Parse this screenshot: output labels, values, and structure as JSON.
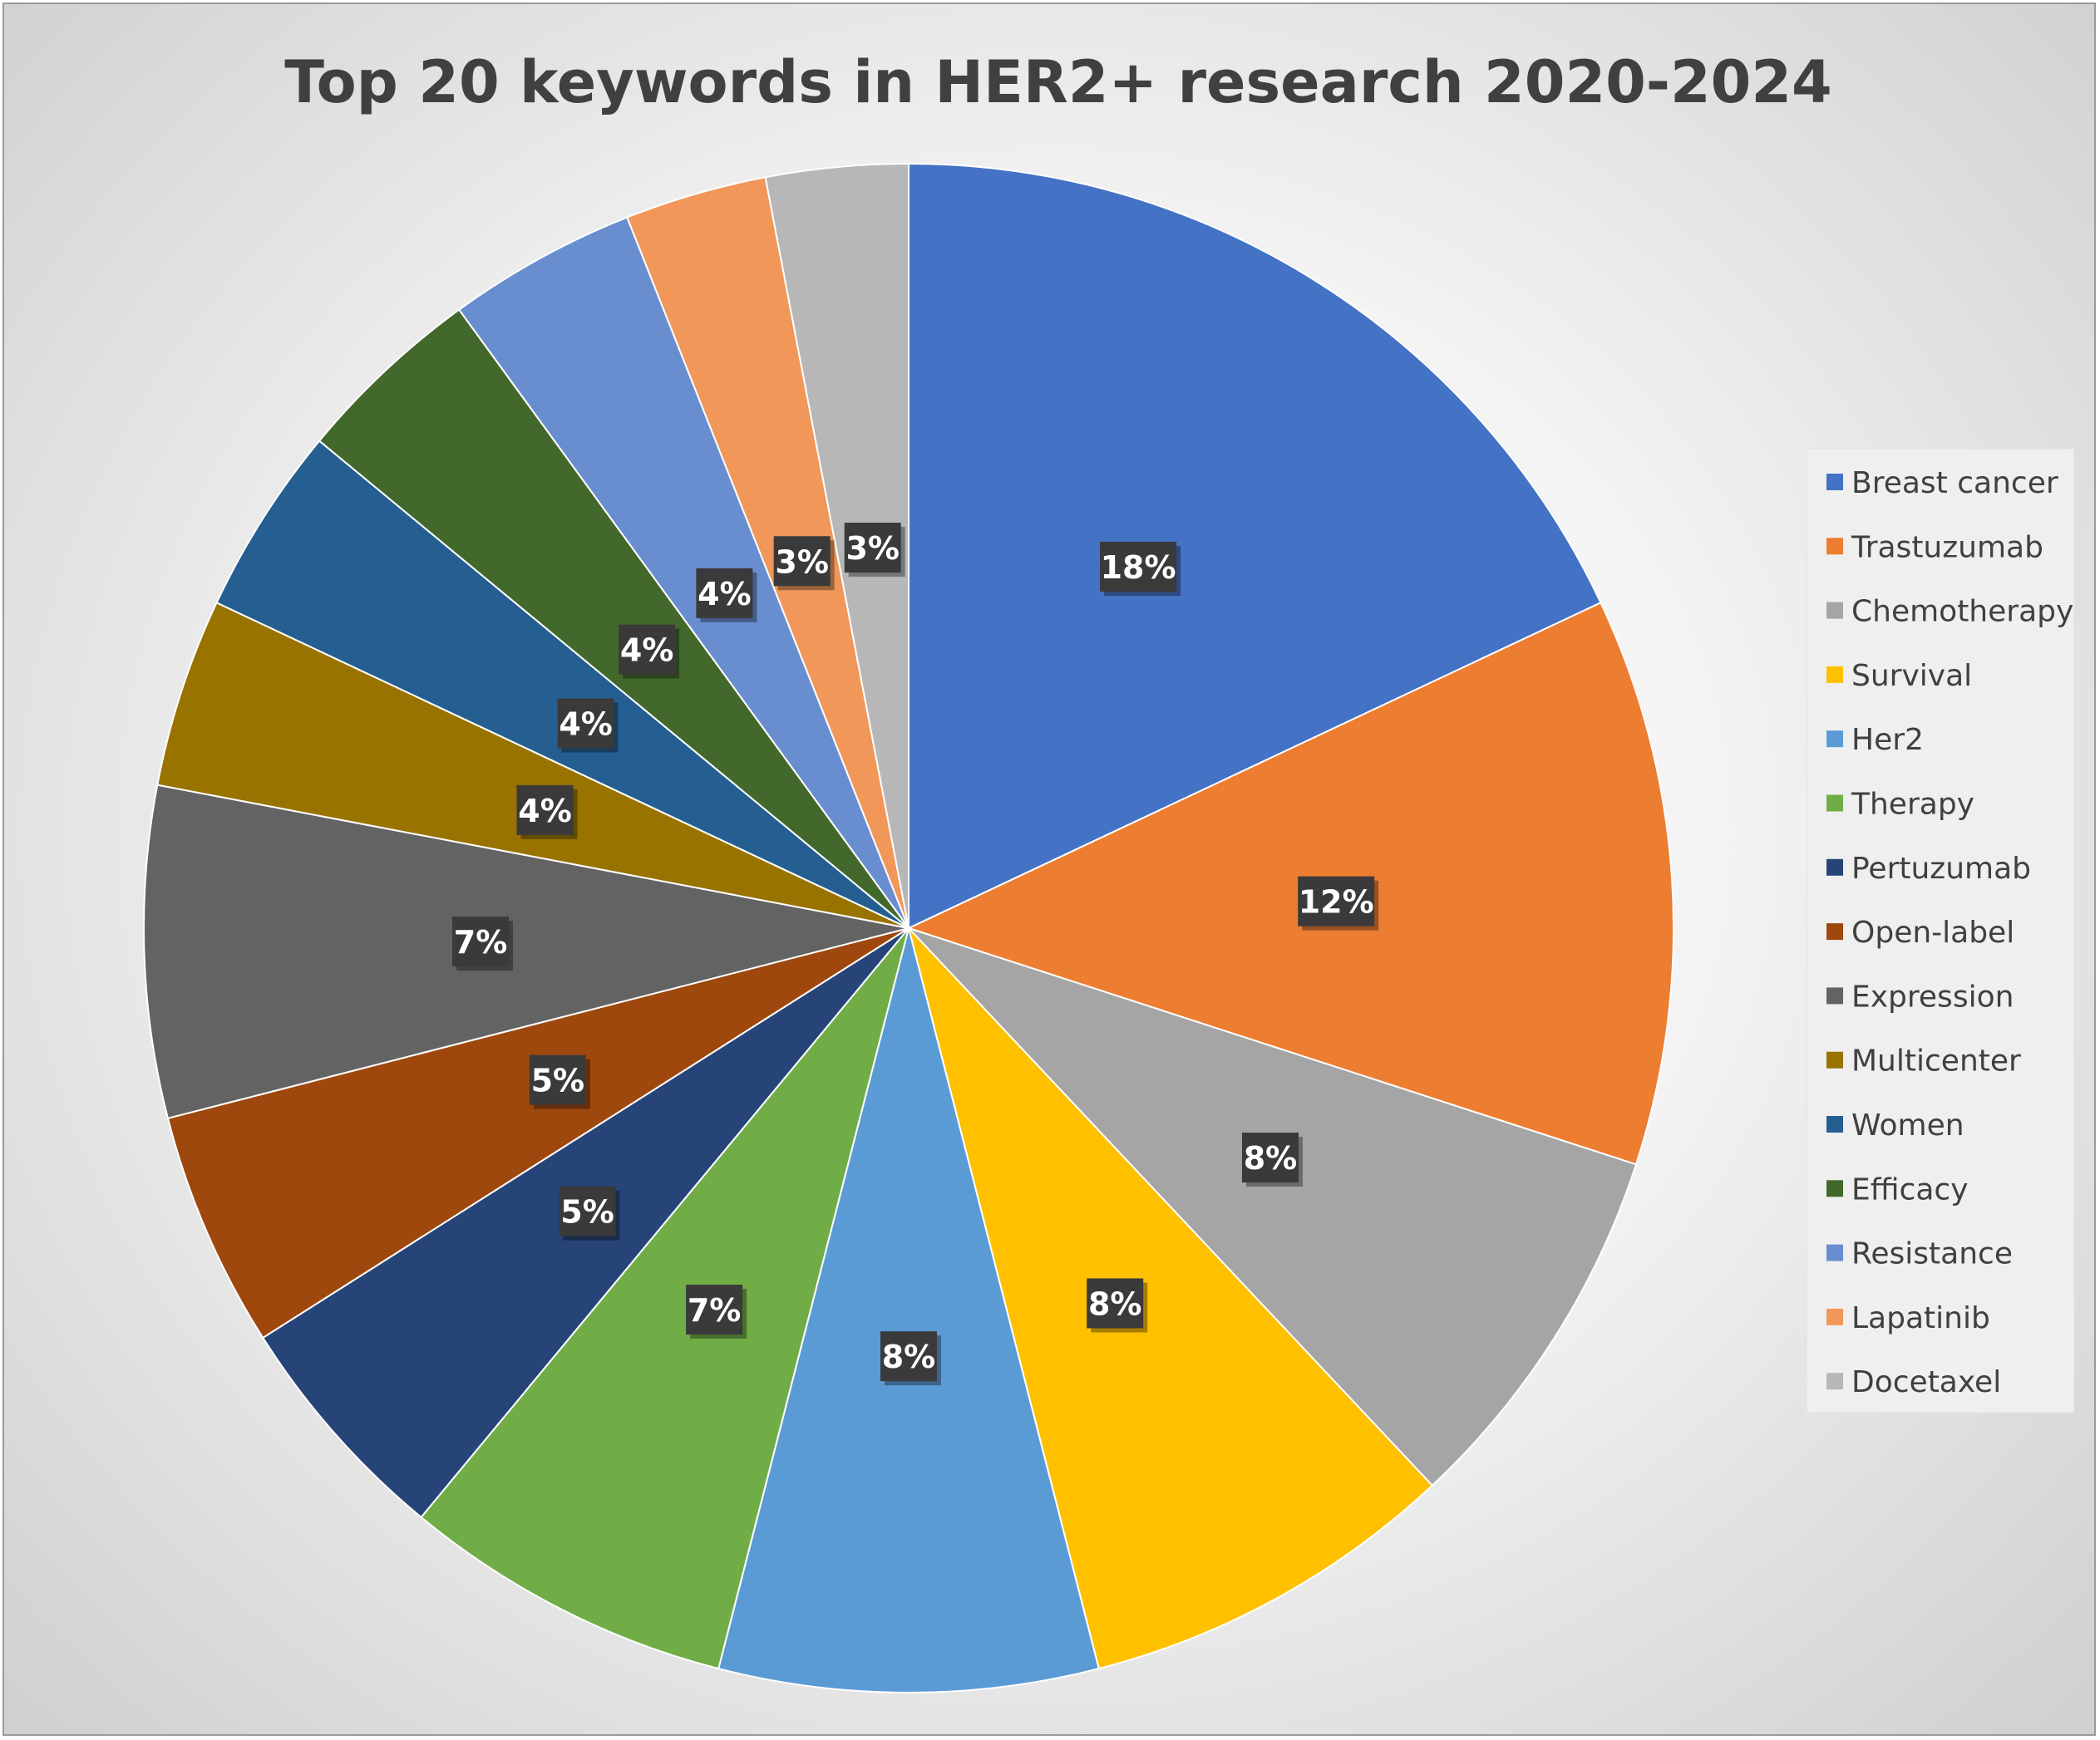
{
  "chart_data": {
    "type": "pie",
    "title": "Top 20 keywords in HER2+ research 2020-2024",
    "legend_position": "right",
    "slices": [
      {
        "label": "Breast cancer",
        "value": 18,
        "display": "18%",
        "color": "#4472C4"
      },
      {
        "label": "Trastuzumab",
        "value": 12,
        "display": "12%",
        "color": "#ED7D31"
      },
      {
        "label": "Chemotherapy",
        "value": 8,
        "display": "8%",
        "color": "#A5A5A5"
      },
      {
        "label": "Survival",
        "value": 8,
        "display": "8%",
        "color": "#FFC000"
      },
      {
        "label": "Her2",
        "value": 8,
        "display": "8%",
        "color": "#5B9BD5"
      },
      {
        "label": "Therapy",
        "value": 7,
        "display": "7%",
        "color": "#70AD47"
      },
      {
        "label": "Pertuzumab",
        "value": 5,
        "display": "5%",
        "color": "#264478"
      },
      {
        "label": "Open-label",
        "value": 5,
        "display": "5%",
        "color": "#9E480E"
      },
      {
        "label": "Expression",
        "value": 7,
        "display": "7%",
        "color": "#636363"
      },
      {
        "label": "Multicenter",
        "value": 4,
        "display": "4%",
        "color": "#997300"
      },
      {
        "label": "Women",
        "value": 4,
        "display": "4%",
        "color": "#255E91"
      },
      {
        "label": "Efficacy",
        "value": 4,
        "display": "4%",
        "color": "#43682B"
      },
      {
        "label": "Resistance",
        "value": 4,
        "display": "4%",
        "color": "#698ED0"
      },
      {
        "label": "Lapatinib",
        "value": 3,
        "display": "3%",
        "color": "#F1975A"
      },
      {
        "label": "Docetaxel",
        "value": 3,
        "display": "3%",
        "color": "#B7B7B7"
      }
    ]
  }
}
